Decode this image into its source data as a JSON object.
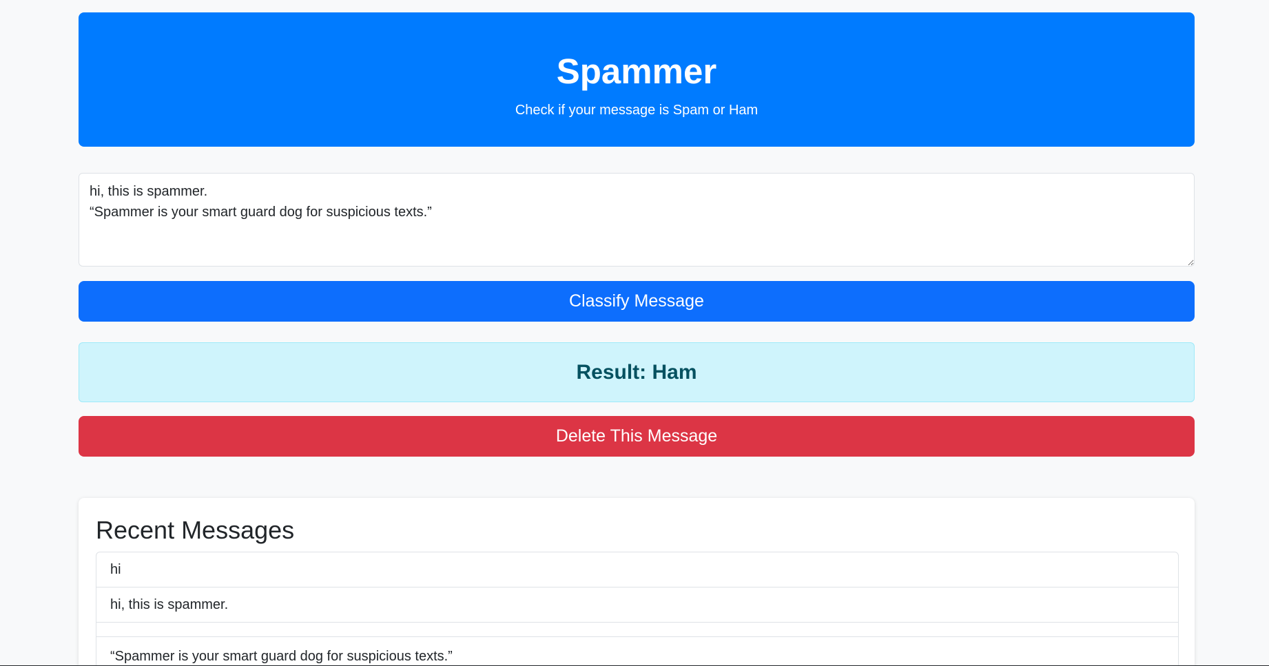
{
  "header": {
    "title": "Spammer",
    "subtitle": "Check if your message is Spam or Ham"
  },
  "form": {
    "message_value": "hi, this is spammer.\n“Spammer is your smart guard dog for suspicious texts.”",
    "classify_label": "Classify Message"
  },
  "result": {
    "text": "Result: Ham"
  },
  "actions": {
    "delete_label": "Delete This Message"
  },
  "recent": {
    "title": "Recent Messages",
    "items": [
      "hi",
      "hi, this is spammer.",
      "",
      "“Spammer is your smart guard dog for suspicious texts.”"
    ]
  },
  "colors": {
    "header_bg": "#007bff",
    "classify_button": "#0d6efd",
    "result_bg": "#cff4fc",
    "result_text": "#055160",
    "delete_button": "#dc3545",
    "page_bg": "#f8f9fa"
  }
}
